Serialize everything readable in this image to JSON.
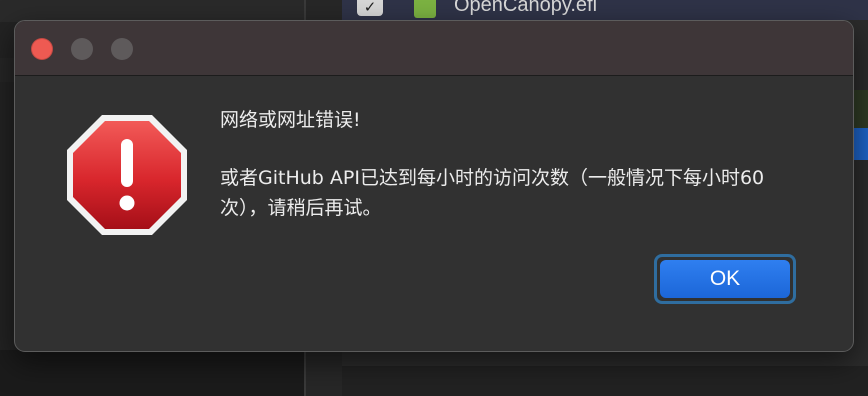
{
  "background": {
    "file_checked": true,
    "file_label": "OpenCanopy.efi",
    "file_icon": "green-file-icon"
  },
  "dialog": {
    "window_controls": [
      "close",
      "minimize",
      "zoom"
    ],
    "icon": "stop-sign-exclamation-icon",
    "title": "网络或网址错误!",
    "body": "或者GitHub API已达到每小时的访问次数（一般情况下每小时60次），请稍后再试。",
    "ok_label": "OK"
  },
  "colors": {
    "accent": "#1d6fe3",
    "close_light": "#ee5a52",
    "stop_red": "#d0202a"
  }
}
